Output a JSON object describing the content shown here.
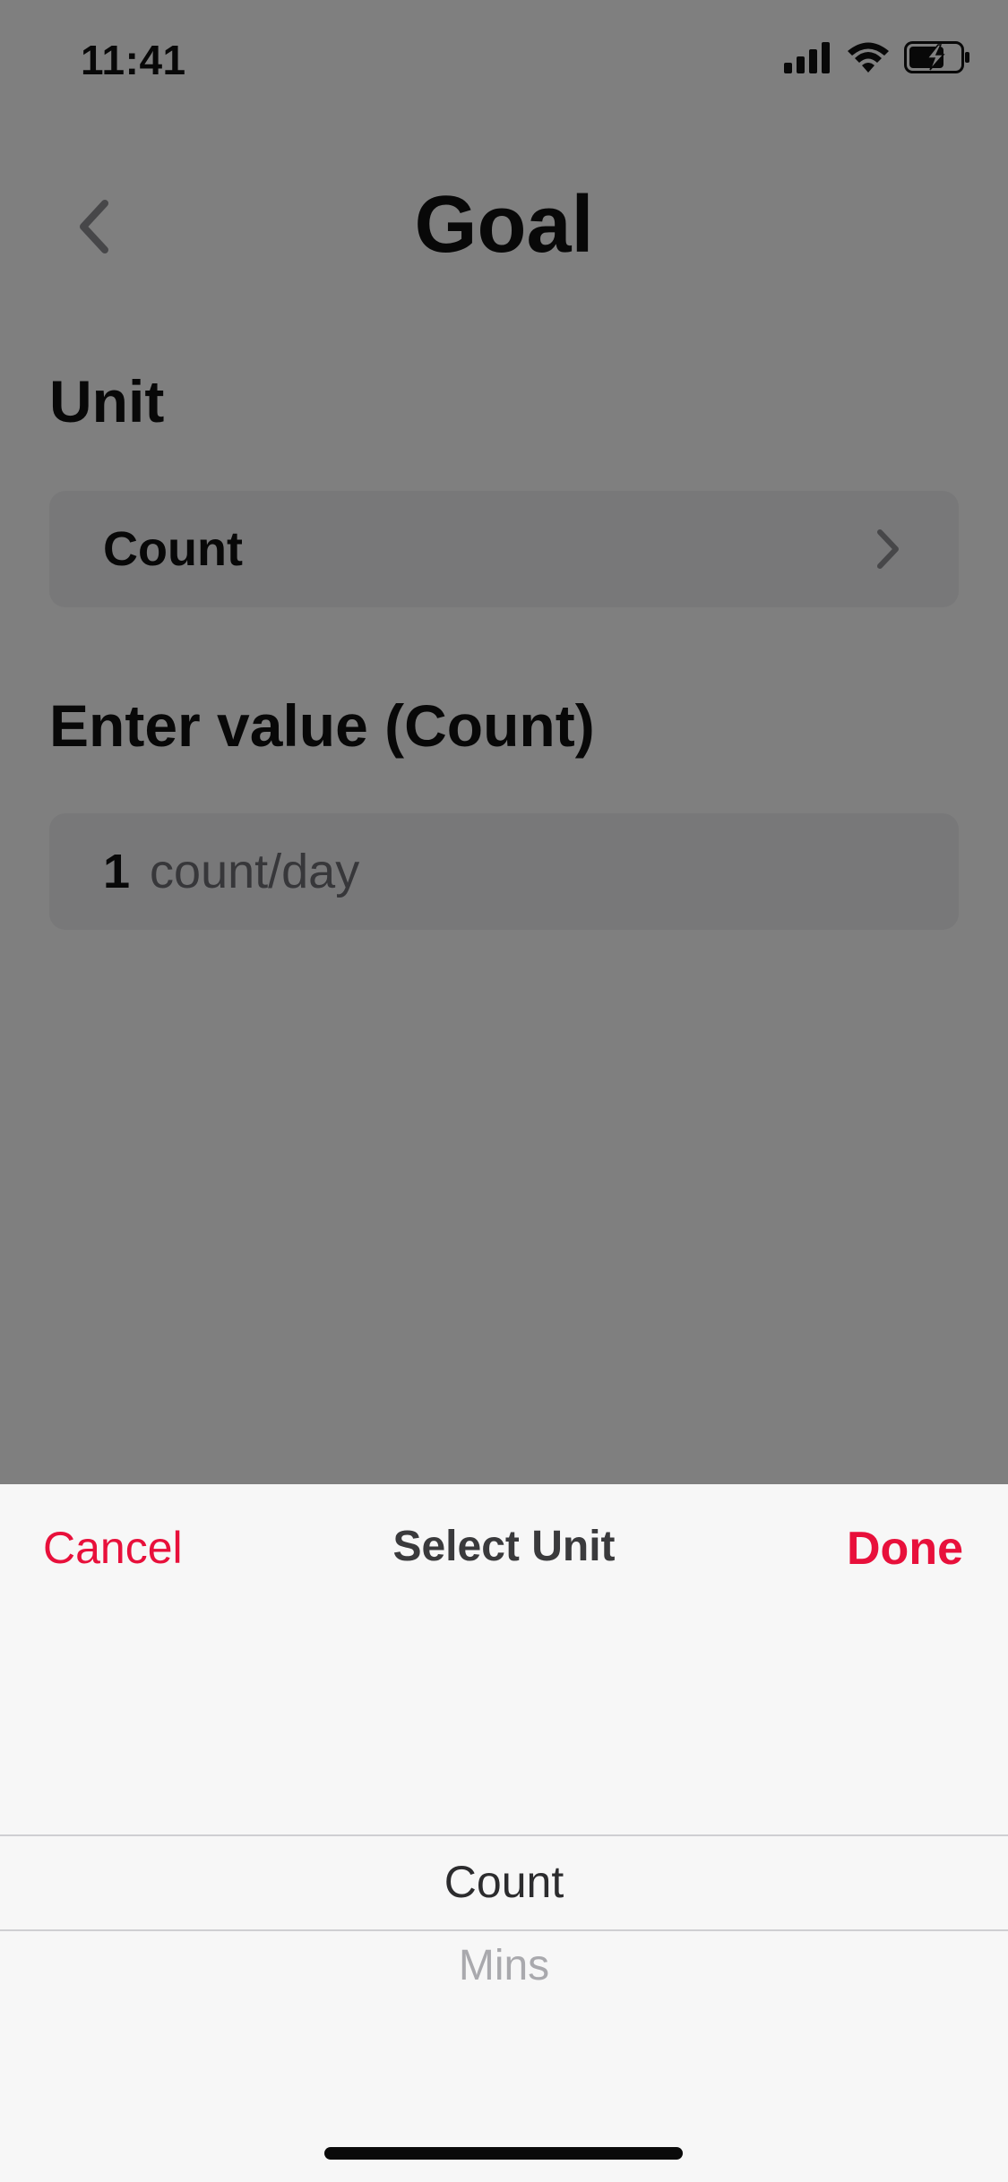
{
  "status_bar": {
    "time": "11:41",
    "icons": [
      "cellular-signal-icon",
      "wifi-icon",
      "battery-charging-icon"
    ]
  },
  "header": {
    "back_icon": "chevron-left-icon",
    "title": "Goal"
  },
  "unit_section": {
    "label": "Unit",
    "value": "Count",
    "chevron_icon": "chevron-right-icon"
  },
  "value_section": {
    "label": "Enter value (Count)",
    "number": "1",
    "unit": "count/day"
  },
  "sheet": {
    "cancel_label": "Cancel",
    "title": "Select Unit",
    "done_label": "Done",
    "options": [
      "Count",
      "Mins"
    ],
    "selected": "Count"
  },
  "colors": {
    "accent": "#e8103b",
    "field_background": "#f0f0f2",
    "overlay": "rgba(0,0,0,0.5)",
    "sheet_background": "#f7f7f7"
  }
}
